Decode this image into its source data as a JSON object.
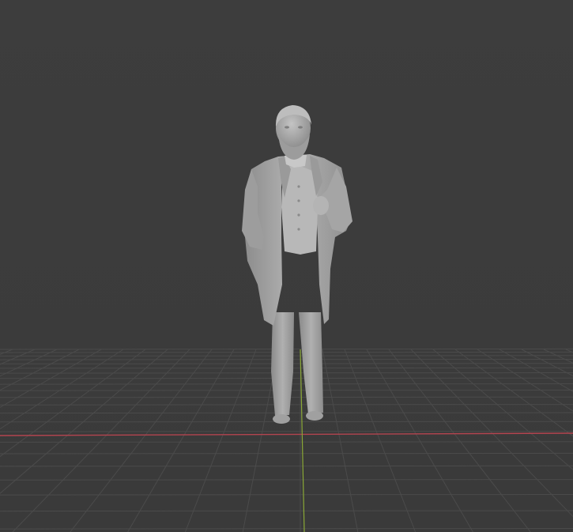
{
  "viewport": {
    "background_color": "#3d3d3d",
    "grid_color": "#4b4b4b",
    "grid_major_color": "#545454",
    "x_axis_color": "#b3444f",
    "y_axis_color": "#8aa836",
    "object_color": "#a9a9a9",
    "object_shadow_color": "#7e7e7e",
    "object_highlight_color": "#c9c9c9"
  },
  "scene": {
    "object_icon": "human-statue-sculpt",
    "floor_grid": "perspective-grid"
  }
}
